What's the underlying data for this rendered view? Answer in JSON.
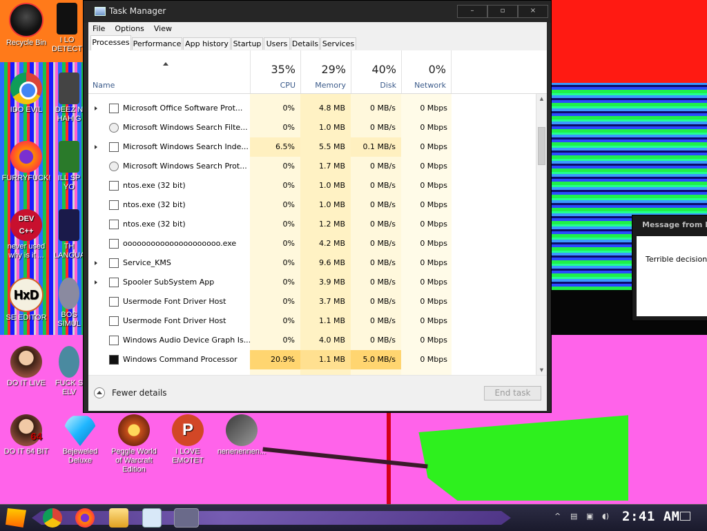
{
  "desktop": {
    "icons": [
      {
        "label": "Recycle Bin"
      },
      {
        "label": "I LO DETECT"
      },
      {
        "label": "IDO EVIL"
      },
      {
        "label": "DEEZ N HAH G"
      },
      {
        "label": "FURRYFUCK!"
      },
      {
        "label": "ILL SP YO"
      },
      {
        "label": "never used why is it ..."
      },
      {
        "label": "TH LANGUA"
      },
      {
        "label": "SE EDITOR"
      },
      {
        "label": "BOS SIMUL"
      },
      {
        "label": "DO IT LIVE"
      },
      {
        "label": "FUCK S ELV"
      },
      {
        "label": "DO IT 64 BIT"
      },
      {
        "label": "Bejeweled Deluxe"
      },
      {
        "label": "Peggle World of Warcraft Edition"
      },
      {
        "label": "I LOVE EMOTET"
      },
      {
        "label": "nenenennen..."
      }
    ],
    "icon_glyphs": {
      "dev": "DEV C++",
      "hxd": "HxD",
      "ppt": "P",
      "lady64": "64"
    }
  },
  "task_manager": {
    "title": "Task Manager",
    "window_buttons": {
      "minimize": "–",
      "maximize": "▫",
      "close": "×"
    },
    "menu": [
      "File",
      "Options",
      "View"
    ],
    "tabs": [
      "Processes",
      "Performance",
      "App history",
      "Startup",
      "Users",
      "Details",
      "Services"
    ],
    "active_tab": "Processes",
    "columns": {
      "name": "Name",
      "cpu": {
        "percent": "35%",
        "label": "CPU"
      },
      "memory": {
        "percent": "29%",
        "label": "Memory"
      },
      "disk": {
        "percent": "40%",
        "label": "Disk"
      },
      "network": {
        "percent": "0%",
        "label": "Network"
      }
    },
    "processes": [
      {
        "name": "Microsoft Office Software Prot...",
        "cpu": "0%",
        "memory": "4.8 MB",
        "disk": "0 MB/s",
        "network": "0 Mbps"
      },
      {
        "name": "Microsoft Windows Search Filte...",
        "cpu": "0%",
        "memory": "1.0 MB",
        "disk": "0 MB/s",
        "network": "0 Mbps"
      },
      {
        "name": "Microsoft Windows Search Inde...",
        "cpu": "6.5%",
        "memory": "5.5 MB",
        "disk": "0.1 MB/s",
        "network": "0 Mbps"
      },
      {
        "name": "Microsoft Windows Search Prot...",
        "cpu": "0%",
        "memory": "1.7 MB",
        "disk": "0 MB/s",
        "network": "0 Mbps"
      },
      {
        "name": "ntos.exe (32 bit)",
        "cpu": "0%",
        "memory": "1.0 MB",
        "disk": "0 MB/s",
        "network": "0 Mbps"
      },
      {
        "name": "ntos.exe (32 bit)",
        "cpu": "0%",
        "memory": "1.0 MB",
        "disk": "0 MB/s",
        "network": "0 Mbps"
      },
      {
        "name": "ntos.exe (32 bit)",
        "cpu": "0%",
        "memory": "1.2 MB",
        "disk": "0 MB/s",
        "network": "0 Mbps"
      },
      {
        "name": "ooooooooooooooooooooo.exe",
        "cpu": "0%",
        "memory": "4.2 MB",
        "disk": "0 MB/s",
        "network": "0 Mbps"
      },
      {
        "name": "Service_KMS",
        "cpu": "0%",
        "memory": "9.6 MB",
        "disk": "0 MB/s",
        "network": "0 Mbps"
      },
      {
        "name": "Spooler SubSystem App",
        "cpu": "0%",
        "memory": "3.9 MB",
        "disk": "0 MB/s",
        "network": "0 Mbps"
      },
      {
        "name": "Usermode Font Driver Host",
        "cpu": "0%",
        "memory": "3.7 MB",
        "disk": "0 MB/s",
        "network": "0 Mbps"
      },
      {
        "name": "Usermode Font Driver Host",
        "cpu": "0%",
        "memory": "1.1 MB",
        "disk": "0 MB/s",
        "network": "0 Mbps"
      },
      {
        "name": "Windows Audio Device Graph Is...",
        "cpu": "0%",
        "memory": "4.0 MB",
        "disk": "0 MB/s",
        "network": "0 Mbps"
      },
      {
        "name": "Windows Command Processor",
        "cpu": "20.9%",
        "memory": "1.1 MB",
        "disk": "5.0 MB/s",
        "network": "0 Mbps"
      }
    ],
    "footer": {
      "fewer_details": "Fewer details",
      "end_task": "End task"
    }
  },
  "message_box": {
    "title": "Message from NE",
    "text": "Terrible decision."
  },
  "taskbar": {
    "clock": "2:41 AM"
  }
}
